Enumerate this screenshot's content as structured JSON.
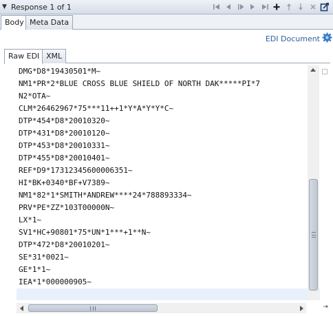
{
  "panel": {
    "title": "Response 1 of 1",
    "toolbar_icons": [
      "first-icon",
      "previous-icon",
      "play-icon",
      "next-icon",
      "last-icon",
      "add-icon",
      "move-up-icon",
      "move-down-icon",
      "delete-icon",
      "export-icon"
    ]
  },
  "tabs": {
    "body": "Body",
    "meta": "Meta Data"
  },
  "edi_document": {
    "label": "EDI Document"
  },
  "subtabs": {
    "raw": "Raw EDI",
    "xml": "XML"
  },
  "lines": [
    "DMG*D8*19430501*M~",
    "NM1*PR*2*BLUE CROSS BLUE SHIELD OF NORTH DAK*****PI*7",
    "N2*OTA~",
    "CLM*26462967*75***11++1*Y*A*Y*Y*C~",
    "DTP*454*D8*20010320~",
    "DTP*431*D8*20010120~",
    "DTP*453*D8*20010331~",
    "DTP*455*D8*20010401~",
    "REF*D9*17312345600006351~",
    "HI*BK+0340*BF+V7389~",
    "NM1*82*1*SMITH*ANDREW****24*788893334~",
    "PRV*PE*ZZ*103T00000N~",
    "LX*1~",
    "SV1*HC+90801*75*UN*1***+1**N~",
    "DTP*472*D8*20010201~",
    "SE*31*0021~",
    "GE*1*1~",
    "IEA*1*000000905~",
    ""
  ]
}
